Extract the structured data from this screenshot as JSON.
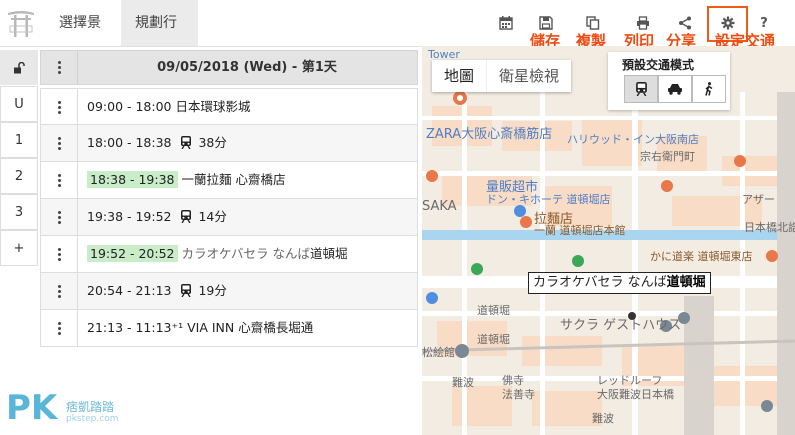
{
  "nav": {
    "tabs": [
      {
        "label": "選擇景點",
        "active": false
      },
      {
        "label": "規劃行程",
        "active": true
      }
    ]
  },
  "toolbar": {
    "tools": [
      {
        "icon": "calendar-icon"
      },
      {
        "icon": "save-icon",
        "callout": "儲存"
      },
      {
        "icon": "copy-icon",
        "callout": "複製"
      },
      {
        "icon": "print-icon",
        "callout": "列印"
      },
      {
        "icon": "share-icon",
        "callout": "分享"
      },
      {
        "icon": "gear-icon",
        "callout": "設定交通"
      },
      {
        "icon": "help-icon",
        "label": "?"
      }
    ],
    "accent": "#ee4b12"
  },
  "side": {
    "lock_icon": "unlock-icon",
    "days": [
      "U",
      "1",
      "2",
      "3",
      "+"
    ]
  },
  "schedule": {
    "header": "09/05/2018 (Wed) - 第1天",
    "rows": [
      {
        "time": "09:00 - 18:00",
        "text": "日本環球影城",
        "type": "place",
        "highlight": false
      },
      {
        "time": "18:00 - 18:38",
        "text": "38分",
        "type": "transit",
        "highlight": false
      },
      {
        "time": "18:38 - 19:38",
        "text": "一蘭拉麵 心齋橋店",
        "type": "place",
        "highlight": true
      },
      {
        "time": "19:38 - 19:52",
        "text": "14分",
        "type": "transit",
        "highlight": false
      },
      {
        "time": "19:52 - 20:52",
        "text": "カラオケバセラ なんば",
        "text_b": "道頓堀",
        "type": "place",
        "highlight": true
      },
      {
        "time": "20:54 - 21:13",
        "text": "19分",
        "type": "transit",
        "highlight": false
      },
      {
        "time": "21:13 - 11:13⁺¹",
        "text": "VIA INN 心齋橋長堀通",
        "type": "place",
        "highlight": false
      }
    ],
    "highlight_color": "#c9ecc9"
  },
  "map": {
    "toggle": [
      "地圖",
      "衛星檢視"
    ],
    "transport_label": "預設交通模式",
    "modes": [
      "train-icon",
      "car-icon",
      "walk-icon"
    ],
    "labels": {
      "tower": "Tower",
      "zara": "ZARA大阪心斎橋筋店",
      "hollywood": "ハリウッド・イン大阪南店",
      "sosaemon": "宗右衛門町",
      "aza": "アザー",
      "kuidaore": "量販超市",
      "donki": "ドン・キホーテ 道頓堀店",
      "osaka": "SAKA",
      "ramen": "拉麵店",
      "ramen_sub": "一蘭 道頓堀店本館",
      "kani": "かに道楽 道頓堀東店",
      "nippon": "日本橋北誥",
      "dotonbori1": "道頓堀",
      "sakura": "サクラ ゲストハウス",
      "dotonbori2": "道頓堀",
      "shoin": "松絵館",
      "nanba": "難波",
      "hotoke": "佛寺",
      "hozenji": "法善寺",
      "redroof": "レッドルーフ",
      "redroof_sub": "大阪難波日本橋",
      "nanba2": "難波"
    },
    "place_label_a": "カラオケバセラ なんば",
    "place_label_b": "道頓堀"
  },
  "watermark": {
    "logo": "PK",
    "text": "痞凱踏踏",
    "sub": "pkstep.com"
  }
}
